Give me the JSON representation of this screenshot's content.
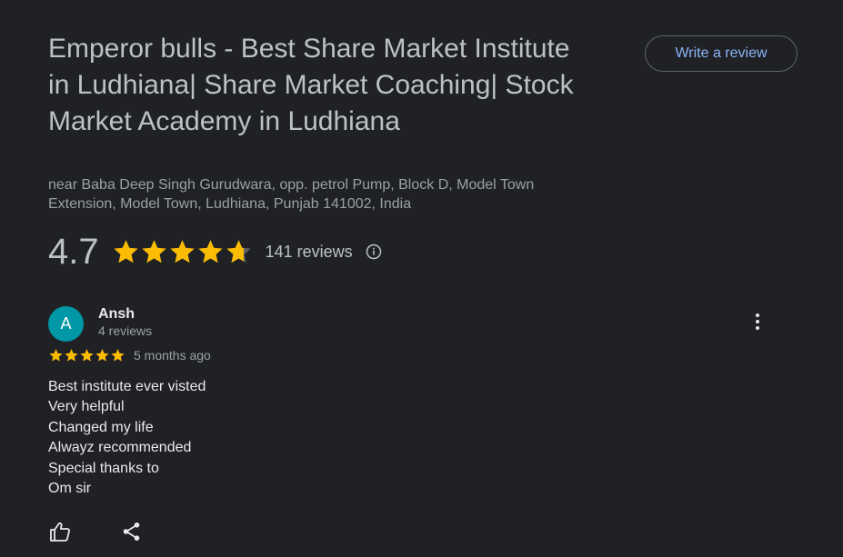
{
  "business": {
    "title": "Emperor bulls - Best Share Market Institute in Ludhiana| Share Market Coaching| Stock Market Academy in Ludhiana",
    "address": "near Baba Deep Singh Gurudwara, opp. petrol Pump, Block D, Model Town Extension, Model Town, Ludhiana, Punjab 141002, India",
    "write_review_label": "Write a review"
  },
  "rating": {
    "value": "4.7",
    "stars": 4.7,
    "count_label": "141 reviews"
  },
  "review": {
    "avatar_letter": "A",
    "avatar_color": "#0097a7",
    "author": "Ansh",
    "author_reviews": "4 reviews",
    "stars": 5,
    "date": "5 months ago",
    "lines": [
      "Best institute ever visted",
      "Very helpful",
      "Changed my life",
      "Alwayz recommended",
      "Special thanks to",
      "Om sir"
    ]
  },
  "icons": {
    "info": "info-icon",
    "more": "more-vert-icon",
    "like": "thumb-up-icon",
    "share": "share-icon"
  },
  "colors": {
    "star": "#fbbc04",
    "star_empty": "#5f6368",
    "link": "#8ab4f8",
    "background": "#202124"
  }
}
